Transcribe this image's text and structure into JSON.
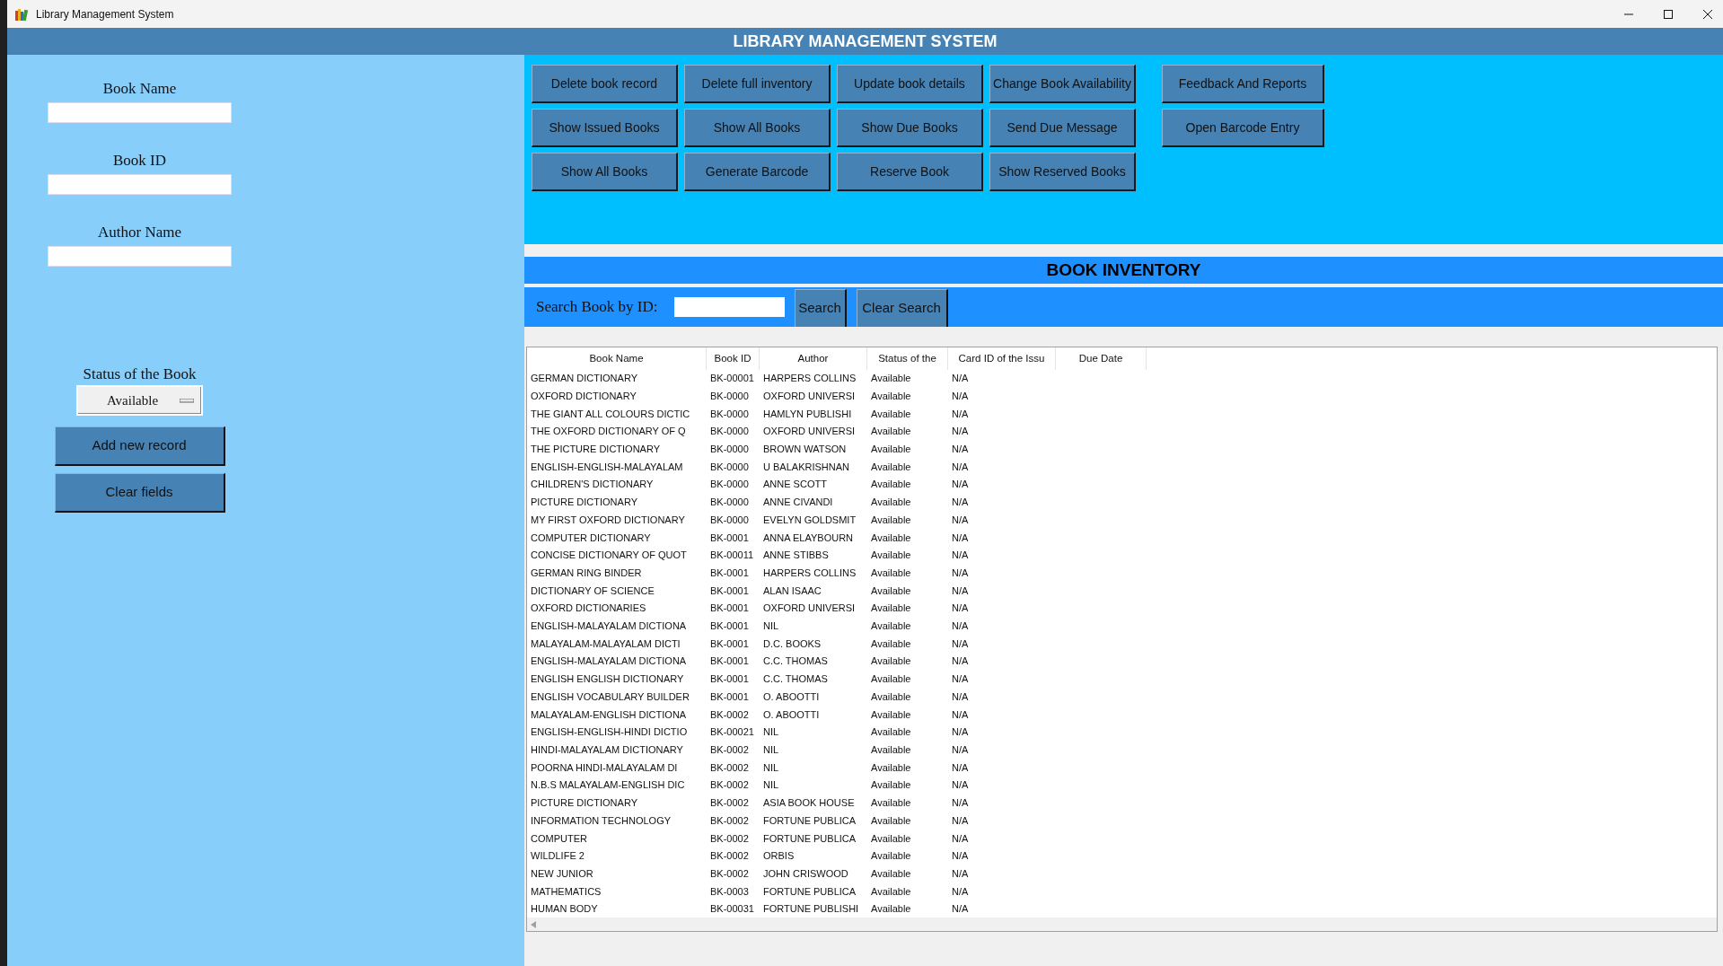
{
  "window": {
    "title": "Library Management System"
  },
  "header": {
    "title": "LIBRARY MANAGEMENT SYSTEM"
  },
  "form": {
    "fields": [
      {
        "label": "Book Name"
      },
      {
        "label": "Book ID"
      },
      {
        "label": "Author Name"
      }
    ],
    "status": {
      "label": "Status of the Book",
      "value": "Available"
    },
    "buttons": [
      "Add new record",
      "Clear fields"
    ]
  },
  "actions": [
    [
      "Delete book record",
      "Delete full inventory",
      "Update book details",
      "Change Book Availability",
      "Feedback And Reports"
    ],
    [
      "Show Issued Books",
      "Show All Books",
      "Show Due Books",
      "Send Due Message",
      "Open Barcode Entry"
    ],
    [
      "Show All Books",
      "Generate Barcode",
      "Reserve Book",
      "Show Reserved Books"
    ]
  ],
  "inventory": {
    "title": "BOOK INVENTORY"
  },
  "search": {
    "label": "Search Book by ID:",
    "buttons": [
      "Search",
      "Clear Search"
    ]
  },
  "table": {
    "columns": [
      "Book Name",
      "Book ID",
      "Author",
      "Status of the",
      "Card ID of the Issu",
      "Due Date"
    ],
    "rows": [
      [
        "GERMAN DICTIONARY",
        "BK-00001",
        "HARPERS COLLINS",
        "Available",
        "N/A"
      ],
      [
        "OXFORD DICTIONARY",
        "BK-0000",
        "OXFORD UNIVERSI",
        "Available",
        "N/A"
      ],
      [
        "THE GIANT ALL COLOURS DICTIC",
        "BK-0000",
        "HAMLYN PUBLISHI",
        "Available",
        "N/A"
      ],
      [
        "THE OXFORD DICTIONARY OF Q",
        "BK-0000",
        "OXFORD UNIVERSI",
        "Available",
        "N/A"
      ],
      [
        "THE PICTURE DICTIONARY",
        "BK-0000",
        "BROWN WATSON",
        "Available",
        "N/A"
      ],
      [
        "ENGLISH-ENGLISH-MALAYALAM",
        "BK-0000",
        "U BALAKRISHNAN",
        "Available",
        "N/A"
      ],
      [
        "CHILDREN'S DICTIONARY",
        "BK-0000",
        "ANNE SCOTT",
        "Available",
        "N/A"
      ],
      [
        "PICTURE DICTIONARY",
        "BK-0000",
        "ANNE CIVANDI",
        "Available",
        "N/A"
      ],
      [
        "MY FIRST OXFORD DICTIONARY",
        "BK-0000",
        "EVELYN GOLDSMIT",
        "Available",
        "N/A"
      ],
      [
        "COMPUTER DICTIONARY",
        "BK-0001",
        "ANNA ELAYBOURN",
        "Available",
        "N/A"
      ],
      [
        "CONCISE DICTIONARY OF QUOT",
        "BK-00011",
        "ANNE STIBBS",
        "Available",
        "N/A"
      ],
      [
        "GERMAN RING BINDER",
        "BK-0001",
        "HARPERS COLLINS",
        "Available",
        "N/A"
      ],
      [
        "DICTIONARY OF SCIENCE",
        "BK-0001",
        "ALAN ISAAC",
        "Available",
        "N/A"
      ],
      [
        "OXFORD DICTIONARIES",
        "BK-0001",
        "OXFORD UNIVERSI",
        "Available",
        "N/A"
      ],
      [
        "ENGLISH-MALAYALAM DICTIONA",
        "BK-0001",
        "NIL",
        "Available",
        "N/A"
      ],
      [
        "MALAYALAM-MALAYALAM DICTI",
        "BK-0001",
        "D.C. BOOKS",
        "Available",
        "N/A"
      ],
      [
        "ENGLISH-MALAYALAM DICTIONA",
        "BK-0001",
        "C.C. THOMAS",
        "Available",
        "N/A"
      ],
      [
        "ENGLISH ENGLISH DICTIONARY",
        "BK-0001",
        "C.C. THOMAS",
        "Available",
        "N/A"
      ],
      [
        "ENGLISH VOCABULARY BUILDER",
        "BK-0001",
        "O. ABOOTTI",
        "Available",
        "N/A"
      ],
      [
        "MALAYALAM-ENGLISH DICTIONA",
        "BK-0002",
        "O. ABOOTTI",
        "Available",
        "N/A"
      ],
      [
        "ENGLISH-ENGLISH-HINDI DICTIO",
        "BK-00021",
        "NIL",
        "Available",
        "N/A"
      ],
      [
        "HINDI-MALAYALAM DICTIONARY",
        "BK-0002",
        "NIL",
        "Available",
        "N/A"
      ],
      [
        "POORNA HINDI-MALAYALAM DI",
        "BK-0002",
        "NIL",
        "Available",
        "N/A"
      ],
      [
        "N.B.S MALAYALAM-ENGLISH DIC",
        "BK-0002",
        "NIL",
        "Available",
        "N/A"
      ],
      [
        "PICTURE DICTIONARY",
        "BK-0002",
        "ASIA BOOK HOUSE",
        "Available",
        "N/A"
      ],
      [
        "INFORMATION TECHNOLOGY",
        "BK-0002",
        "FORTUNE PUBLICA",
        "Available",
        "N/A"
      ],
      [
        "COMPUTER",
        "BK-0002",
        "FORTUNE PUBLICA",
        "Available",
        "N/A"
      ],
      [
        "WILDLIFE 2",
        "BK-0002",
        "ORBIS",
        "Available",
        "N/A"
      ],
      [
        "NEW JUNIOR",
        "BK-0002",
        "JOHN CRISWOOD",
        "Available",
        "N/A"
      ],
      [
        "MATHEMATICS",
        "BK-0003",
        "FORTUNE PUBLICA",
        "Available",
        "N/A"
      ],
      [
        "HUMAN BODY",
        "BK-00031",
        "FORTUNE PUBLISHI",
        "Available",
        "N/A"
      ]
    ]
  }
}
